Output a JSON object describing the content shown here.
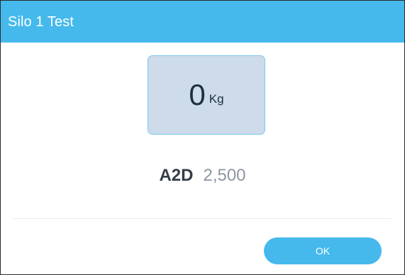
{
  "dialog": {
    "title": "Silo 1 Test"
  },
  "weight": {
    "value": "0",
    "unit": "Kg"
  },
  "a2d": {
    "label": "A2D",
    "value": "2,500"
  },
  "actions": {
    "ok_label": "OK"
  },
  "colors": {
    "accent": "#45b9ec",
    "weight_box_bg": "#cddbea"
  }
}
